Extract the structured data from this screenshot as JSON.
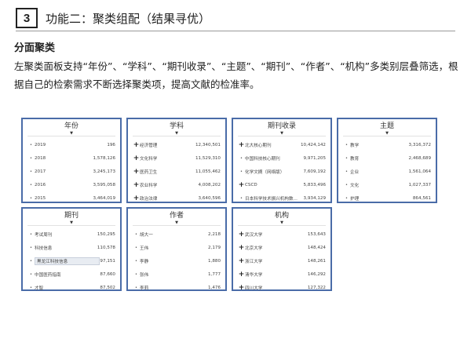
{
  "header": {
    "number": "3",
    "title": "功能二：聚类组配（结果寻优）"
  },
  "section": {
    "title": "分面聚类",
    "paragraph": "左聚类面板支持“年份”、“学科”、“期刊收录”、“主题”、“期刊”、“作者”、“机构”多类别层叠筛选，根据自己的检索需求不断选择聚类项，提高文献的检准率。"
  },
  "panels": [
    {
      "title": "年份",
      "items": [
        {
          "label": "2019",
          "count": "196",
          "marker": "dot"
        },
        {
          "label": "2018",
          "count": "1,578,126",
          "marker": "dot"
        },
        {
          "label": "2017",
          "count": "3,245,173",
          "marker": "dot"
        },
        {
          "label": "2016",
          "count": "3,595,058",
          "marker": "dot"
        },
        {
          "label": "2015",
          "count": "3,464,019",
          "marker": "dot"
        }
      ]
    },
    {
      "title": "学科",
      "items": [
        {
          "label": "经济管理",
          "count": "12,340,501",
          "marker": "plus"
        },
        {
          "label": "文化科学",
          "count": "11,529,310",
          "marker": "plus"
        },
        {
          "label": "医药卫生",
          "count": "11,055,462",
          "marker": "plus"
        },
        {
          "label": "农业科学",
          "count": "4,008,202",
          "marker": "plus"
        },
        {
          "label": "政治法律",
          "count": "3,640,596",
          "marker": "plus"
        }
      ]
    },
    {
      "title": "期刊收录",
      "items": [
        {
          "label": "北大核心期刊",
          "count": "10,424,142",
          "marker": "plus"
        },
        {
          "label": "中国科技核心期刊",
          "count": "9,971,205",
          "marker": "dot"
        },
        {
          "label": "化学文摘（网络版）",
          "count": "7,609,192",
          "marker": "dot"
        },
        {
          "label": "CSCD",
          "count": "5,833,496",
          "marker": "plus"
        },
        {
          "label": "日本科学技术振兴机构数...",
          "count": "3,934,129",
          "marker": "dot"
        }
      ]
    },
    {
      "title": "主题",
      "items": [
        {
          "label": "教学",
          "count": "3,316,372",
          "marker": "dot"
        },
        {
          "label": "教育",
          "count": "2,468,689",
          "marker": "dot"
        },
        {
          "label": "企业",
          "count": "1,561,064",
          "marker": "dot"
        },
        {
          "label": "文化",
          "count": "1,027,337",
          "marker": "dot"
        },
        {
          "label": "护理",
          "count": "864,561",
          "marker": "dot"
        }
      ]
    },
    {
      "title": "期刊",
      "items": [
        {
          "label": "考试周刊",
          "count": "150,295",
          "marker": "dot"
        },
        {
          "label": "科技信息",
          "count": "110,578",
          "marker": "dot"
        },
        {
          "label": "黑龙江科技信息",
          "count": "97,151",
          "marker": "dot",
          "highlight": true
        },
        {
          "label": "中国医药指南",
          "count": "87,660",
          "marker": "dot"
        },
        {
          "label": "才智",
          "count": "87,502",
          "marker": "dot"
        }
      ]
    },
    {
      "title": "作者",
      "items": [
        {
          "label": "胡大一",
          "count": "2,218",
          "marker": "dot"
        },
        {
          "label": "王伟",
          "count": "2,179",
          "marker": "dot"
        },
        {
          "label": "李静",
          "count": "1,880",
          "marker": "dot"
        },
        {
          "label": "张伟",
          "count": "1,777",
          "marker": "dot"
        },
        {
          "label": "李莉",
          "count": "1,476",
          "marker": "dot"
        }
      ]
    },
    {
      "title": "机构",
      "items": [
        {
          "label": "武汉大学",
          "count": "153,643",
          "marker": "plus"
        },
        {
          "label": "北京大学",
          "count": "148,424",
          "marker": "plus"
        },
        {
          "label": "浙江大学",
          "count": "148,261",
          "marker": "plus"
        },
        {
          "label": "清华大学",
          "count": "146,292",
          "marker": "plus"
        },
        {
          "label": "四川大学",
          "count": "127,322",
          "marker": "plus"
        }
      ]
    }
  ]
}
